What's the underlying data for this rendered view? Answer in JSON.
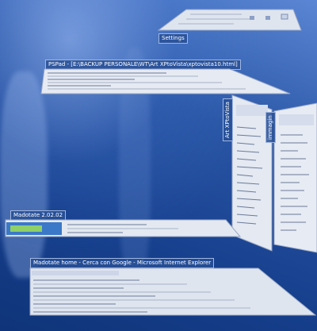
{
  "windows": {
    "settings": {
      "title": "Settings"
    },
    "pspad": {
      "title": "PSPad - [E:\\BACKUP PERSONALE\\WT\\Art XPtoVista\\xptovista10.html]"
    },
    "art_xptovista": {
      "title": "Art XPtoVista"
    },
    "immagini": {
      "title": "immagin"
    },
    "madotate": {
      "title": "Madotate 2.02.02"
    },
    "ie": {
      "title": "Madotate home - Cerca con Google - Microsoft Internet Explorer"
    }
  }
}
